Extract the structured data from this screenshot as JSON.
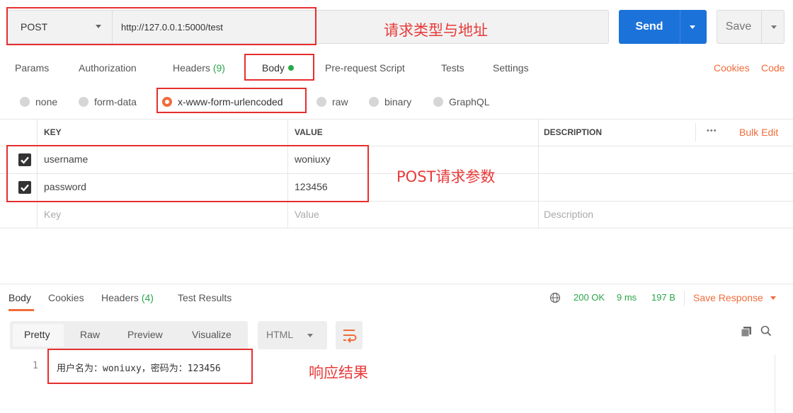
{
  "request": {
    "method": "POST",
    "url": "http://127.0.0.1:5000/test",
    "send_label": "Send",
    "save_label": "Save"
  },
  "annotations": {
    "request_type": "请求类型与地址",
    "post_params": "POST请求参数",
    "response_result": "响应结果"
  },
  "request_tabs": {
    "params": "Params",
    "authorization": "Authorization",
    "headers": "Headers",
    "headers_count": "(9)",
    "body": "Body",
    "pre_request": "Pre-request Script",
    "tests": "Tests",
    "settings": "Settings",
    "cookies": "Cookies",
    "code": "Code"
  },
  "body_types": {
    "none": "none",
    "form_data": "form-data",
    "urlencoded": "x-www-form-urlencoded",
    "raw": "raw",
    "binary": "binary",
    "graphql": "GraphQL",
    "selected": "x-www-form-urlencoded"
  },
  "params_table": {
    "headers": {
      "key": "KEY",
      "value": "VALUE",
      "description": "DESCRIPTION",
      "more": "•••",
      "bulk_edit": "Bulk Edit"
    },
    "rows": [
      {
        "checked": true,
        "key": "username",
        "value": "woniuxy"
      },
      {
        "checked": true,
        "key": "password",
        "value": "123456"
      }
    ],
    "placeholders": {
      "key": "Key",
      "value": "Value",
      "description": "Description"
    }
  },
  "response": {
    "tabs": {
      "body": "Body",
      "cookies": "Cookies",
      "headers": "Headers",
      "headers_count": "(4)",
      "test_results": "Test Results"
    },
    "status": "200 OK",
    "time": "9 ms",
    "size": "197 B",
    "save_response": "Save Response",
    "view_modes": {
      "pretty": "Pretty",
      "raw": "Raw",
      "preview": "Preview",
      "visualize": "Visualize"
    },
    "format": "HTML",
    "line_number": "1",
    "body_text": "用户名为：woniuxy，密码为：123456"
  },
  "colors": {
    "send_blue": "#1b72d9",
    "accent_orange": "#f26b3a",
    "status_green": "#2aa54a",
    "annotation_red": "#e62e2e"
  }
}
